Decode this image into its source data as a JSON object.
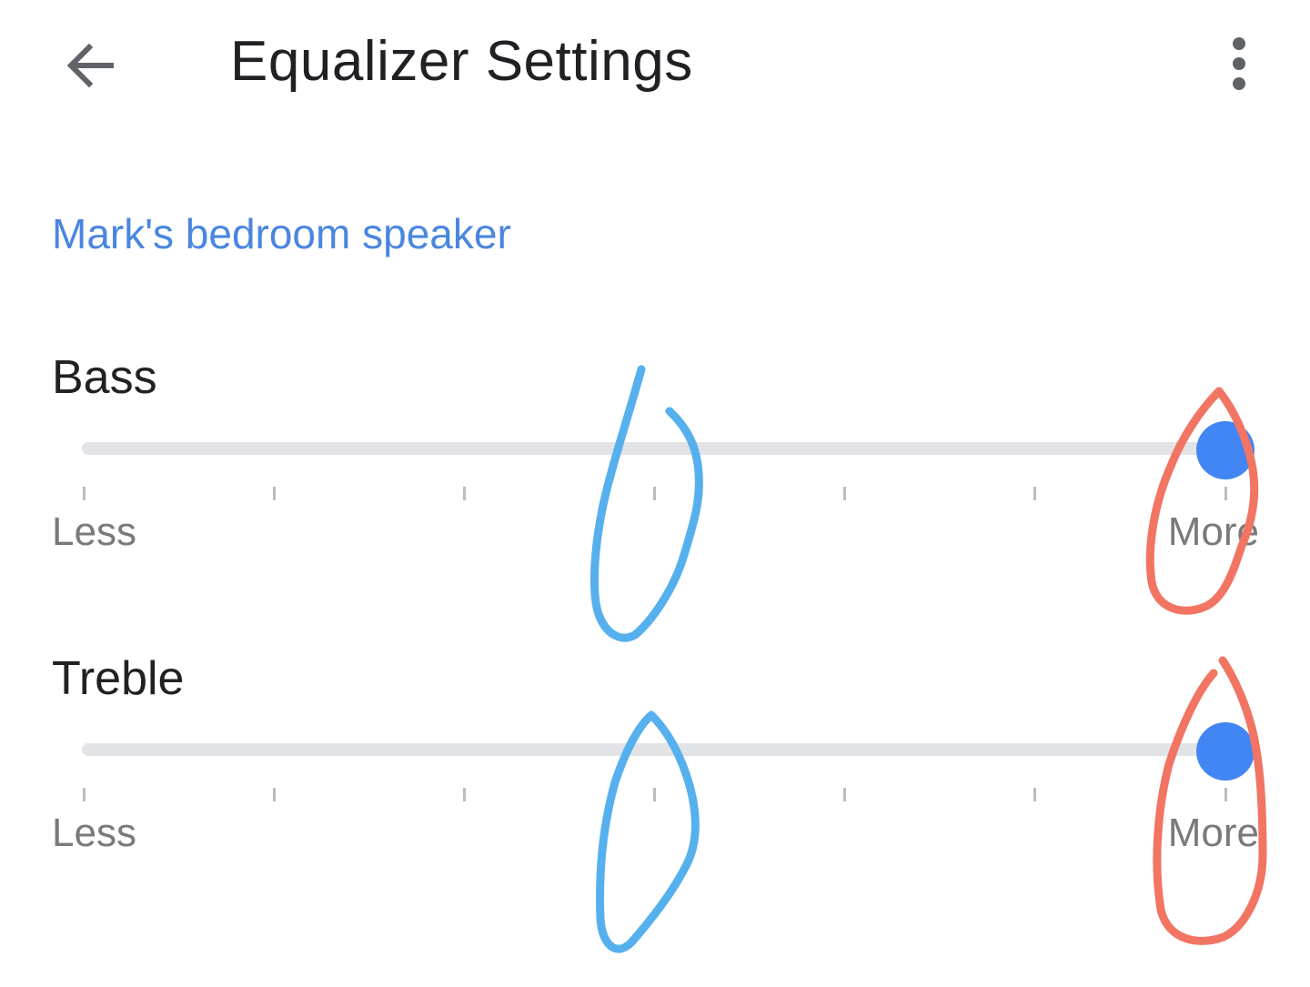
{
  "app_bar": {
    "back_icon": "arrow-back-icon",
    "title": "Equalizer Settings",
    "overflow_icon": "more-vert-icon"
  },
  "section": {
    "title": "Mark's bedroom speaker"
  },
  "equalizer": {
    "steps": 6,
    "bands": [
      {
        "label": "Bass",
        "value": 6,
        "min_label": "Less",
        "max_label": "More"
      },
      {
        "label": "Treble",
        "value": 6,
        "min_label": "Less",
        "max_label": "More"
      }
    ]
  },
  "colors": {
    "accent": "#4285f4",
    "section_header": "#4a86e0",
    "annotation_blue": "#56b0ee",
    "annotation_red": "#f27463"
  }
}
